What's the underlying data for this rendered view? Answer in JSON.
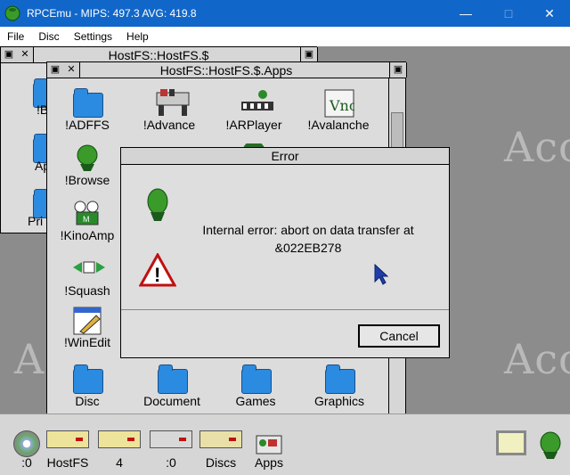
{
  "host": {
    "title": "RPCEmu - MIPS: 497.3 AVG: 419.8",
    "menus": [
      "File",
      "Disc",
      "Settings",
      "Help"
    ]
  },
  "desktop": {
    "watermark": "Aco"
  },
  "back_window": {
    "title": "HostFS::HostFS.$",
    "partial_items": [
      "!B",
      "Ap",
      "Pri"
    ]
  },
  "apps_window": {
    "title": "HostFS::HostFS.$.Apps",
    "items": [
      {
        "label": "!ADFFS",
        "icon": "folder-icon"
      },
      {
        "label": "!Advance",
        "icon": "advance-icon"
      },
      {
        "label": "!ARPlayer",
        "icon": "arplayer-icon"
      },
      {
        "label": "!Avalanche",
        "icon": "avalanche-icon"
      },
      {
        "label": "!Browse",
        "icon": "acorn-icon"
      },
      {
        "label": "!KinoAmp",
        "icon": "kinoamp-icon"
      },
      {
        "label": "!Squash",
        "icon": "squash-icon"
      },
      {
        "label": "!WinEdit",
        "icon": "winedit-icon"
      },
      {
        "label": "Disc",
        "icon": "folder-icon"
      },
      {
        "label": "Document",
        "icon": "folder-icon"
      },
      {
        "label": "Games",
        "icon": "folder-icon"
      },
      {
        "label": "Graphics",
        "icon": "folder-icon"
      }
    ]
  },
  "error_dialog": {
    "title": "Error",
    "message_line1": "Internal error: abort on data transfer at",
    "message_line2": "&022EB278",
    "cancel_label": "Cancel"
  },
  "iconbar": {
    "left": [
      {
        "label": ":0",
        "icon": "cd-drive-icon"
      },
      {
        "label": "HostFS",
        "icon": "hostfs-drive-icon"
      },
      {
        "label": "4",
        "icon": "ide-drive-icon"
      },
      {
        "label": ":0",
        "icon": "floppy-drive-icon"
      },
      {
        "label": "Discs",
        "icon": "discs-icon"
      },
      {
        "label": "Apps",
        "icon": "apps-icon"
      }
    ],
    "right": [
      {
        "label": "",
        "icon": "display-icon"
      },
      {
        "label": "",
        "icon": "acorn-icon"
      }
    ]
  }
}
